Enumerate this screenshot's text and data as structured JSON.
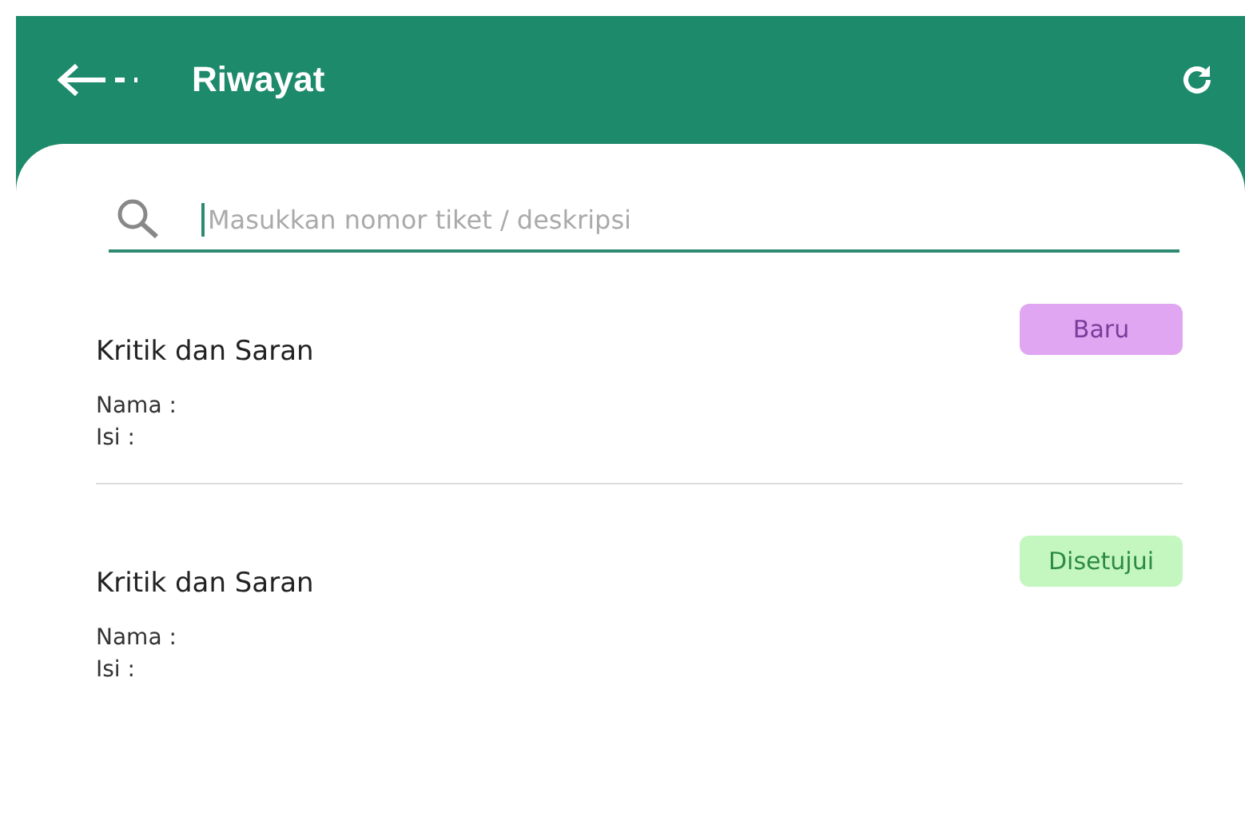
{
  "header": {
    "title": "Riwayat"
  },
  "search": {
    "placeholder": "Masukkan nomor tiket / deskripsi"
  },
  "tickets": [
    {
      "title": "Kritik dan Saran",
      "status": "Baru",
      "color": "#e1a6f2",
      "name_label": "Nama :",
      "content_label": "Isi :"
    },
    {
      "title": "Kritik dan Saran",
      "status": "Disetujui",
      "color": "#c4f7c0",
      "name_label": "Nama :",
      "content_label": "Isi :"
    }
  ]
}
